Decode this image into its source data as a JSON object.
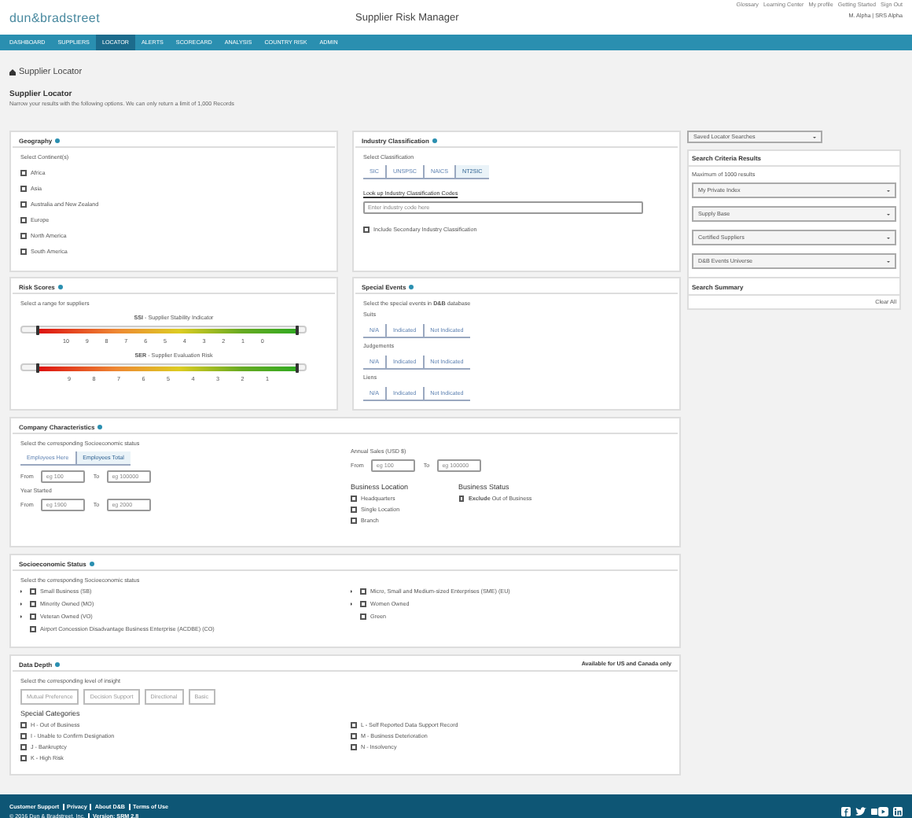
{
  "header": {
    "logo": "dun&bradstreet",
    "title": "Supplier Risk Manager",
    "links": [
      "Glossary",
      "Learning Center",
      "My profile",
      "Getting Started",
      "Sign Out"
    ],
    "user": "M. Alpha | SRS Alpha"
  },
  "nav": [
    {
      "label": "DASHBOARD",
      "selected": false
    },
    {
      "label": "SUPPLIERS",
      "selected": false
    },
    {
      "label": "LOCATOR",
      "selected": true
    },
    {
      "label": "ALERTS",
      "selected": false
    },
    {
      "label": "SCORECARD",
      "selected": false
    },
    {
      "label": "ANALYSIS",
      "selected": false
    },
    {
      "label": "COUNTRY RISK",
      "selected": false
    },
    {
      "label": "ADMIN",
      "selected": false
    }
  ],
  "page": {
    "title": "Supplier Locator",
    "subtitle": "Supplier Locator",
    "description": "Narrow your results with the following options. We can only return a limit of 1,000 Records"
  },
  "geography": {
    "title": "Geography",
    "label": "Select Continent(s)",
    "options": [
      {
        "label": "Africa",
        "checked": false
      },
      {
        "label": "Asia",
        "checked": false
      },
      {
        "label": "Australia and New Zealand",
        "checked": false
      },
      {
        "label": "Europe",
        "checked": false
      },
      {
        "label": "North America",
        "checked": false
      },
      {
        "label": "South America",
        "checked": false
      }
    ]
  },
  "industry": {
    "title": "Industry Classification",
    "label": "Select Classification",
    "tabs": [
      {
        "label": "SIC",
        "selected": false
      },
      {
        "label": "UNSPSC",
        "selected": false
      },
      {
        "label": "NAICS",
        "selected": false
      },
      {
        "label": "NT2SIC",
        "selected": true
      }
    ],
    "lookup_link": "Look up Industry Classification Codes",
    "placeholder": "Enter industry code here",
    "secondary": {
      "label": "Include Secondary Industry Classification",
      "checked": false
    }
  },
  "risk_scores": {
    "title": "Risk Scores",
    "label": "Select a range for suppliers",
    "sliders": [
      {
        "label": "**SSI** - Supplier Stability Indicator",
        "level": 1,
        "ticks": [
          "10",
          "9",
          "8",
          "7",
          "6",
          "5",
          "4",
          "3",
          "2",
          "1",
          "0"
        ]
      },
      {
        "label": "**SER** - Supplier Evaluation Risk",
        "level": 1,
        "ticks": [
          "9",
          "8",
          "7",
          "6",
          "5",
          "4",
          "3",
          "2",
          "1"
        ]
      }
    ]
  },
  "special_events": {
    "title": "Special Events",
    "label": "Select the special events in **D&B** database",
    "groups": [
      {
        "label": "Suits",
        "options": [
          {
            "label": "N/A",
            "selected": false
          },
          {
            "label": "Indicated",
            "selected": false
          },
          {
            "label": "Not Indicated",
            "selected": false
          }
        ]
      },
      {
        "label": "Judgements",
        "options": [
          {
            "label": "N/A",
            "selected": false
          },
          {
            "label": "Indicated",
            "selected": false
          },
          {
            "label": "Not Indicated",
            "selected": false
          }
        ]
      },
      {
        "label": "Liens",
        "options": [
          {
            "label": "N/A",
            "selected": false
          },
          {
            "label": "Indicated",
            "selected": false
          },
          {
            "label": "Not Indicated",
            "selected": false
          }
        ]
      }
    ]
  },
  "company": {
    "title": "Company Characteristics",
    "label": "Select the corresponding Socioeconomic status",
    "tabs": [
      {
        "label": "Employees Here",
        "selected": false
      },
      {
        "label": "Employees Total",
        "selected": true
      }
    ],
    "from_label": "From",
    "to_label": "To",
    "employees_from_placeholder": "eg 100",
    "employees_to_placeholder": "eg 100000",
    "year_label": "Year Started",
    "year_from_label": "From",
    "year_to_label": "To",
    "year_from_placeholder": "eg 1900",
    "year_to_placeholder": "eg 2000",
    "sales_label": "Annual Sales (USD $)",
    "sales_from_label": "From",
    "sales_to_label": "To",
    "sales_from_placeholder": "eg 100",
    "sales_to_placeholder": "eg 100000",
    "location_title": "Business Location",
    "locations": [
      {
        "label": "Headquarters",
        "checked": false
      },
      {
        "label": "Single Location",
        "checked": false
      },
      {
        "label": "Branch",
        "checked": false
      }
    ],
    "status_title": "Business Status",
    "status": {
      "label": "**Exclude** Out of Business",
      "checked": false
    }
  },
  "socioeconomic": {
    "title": "Socioeconomic Status",
    "label": "Select the corresponding Socioeconomic status",
    "left": [
      {
        "label": "Small Business (SB)",
        "checked": false,
        "expandable": true
      },
      {
        "label": "Minority Owned (MO)",
        "checked": false,
        "expandable": true
      },
      {
        "label": "Veteran Owned (VO)",
        "checked": false,
        "expandable": true
      },
      {
        "label": "Airport Concession Disadvantage Business Enterprise (ACDBE) (CO)",
        "checked": false,
        "expandable": false
      }
    ],
    "right": [
      {
        "label": "Micro, Small and Medium-sized Enterprises (SME) (EU)",
        "checked": false,
        "expandable": true
      },
      {
        "label": "Women Owned",
        "checked": false,
        "expandable": true
      },
      {
        "label": "Green",
        "checked": false,
        "expandable": false
      }
    ]
  },
  "data_depth": {
    "title": "Data Depth",
    "note": "Available for US and Canada only",
    "label": "Select the corresponding level of insight",
    "levels": [
      {
        "label": "Mutual Preference",
        "selected": false
      },
      {
        "label": "Decision Support",
        "selected": false
      },
      {
        "label": "Directional",
        "selected": false
      },
      {
        "label": "Basic",
        "selected": false
      }
    ],
    "categories_title": "Special Categories",
    "left": [
      {
        "label": "H - Out of Business",
        "checked": false
      },
      {
        "label": "I - Unable to Confirm Designation",
        "checked": false
      },
      {
        "label": "J - Bankruptcy",
        "checked": false
      },
      {
        "label": "K - High Risk",
        "checked": false
      }
    ],
    "right": [
      {
        "label": "L - Self Reported Data Support Record",
        "checked": false
      },
      {
        "label": "M - Business Deterioration",
        "checked": false
      },
      {
        "label": "N - Insolvency",
        "checked": false
      }
    ]
  },
  "sidebar": {
    "saved_searches": "Saved Locator Searches",
    "results_title": "Search Criteria Results",
    "max_note": "Maximum of 1000 results",
    "filters": [
      "My Private Index",
      "Supply Base",
      "Certified Suppliers",
      "D&B Events Universe"
    ],
    "summary_title": "Search Summary",
    "clear": "Clear All"
  },
  "footer": {
    "links": [
      "Customer Support",
      "Privacy",
      "About D&B",
      "Terms of Use"
    ],
    "copyright": "© 2016 Dun & Bradstreet, Inc.",
    "version": "Version: SRM 2.8"
  }
}
